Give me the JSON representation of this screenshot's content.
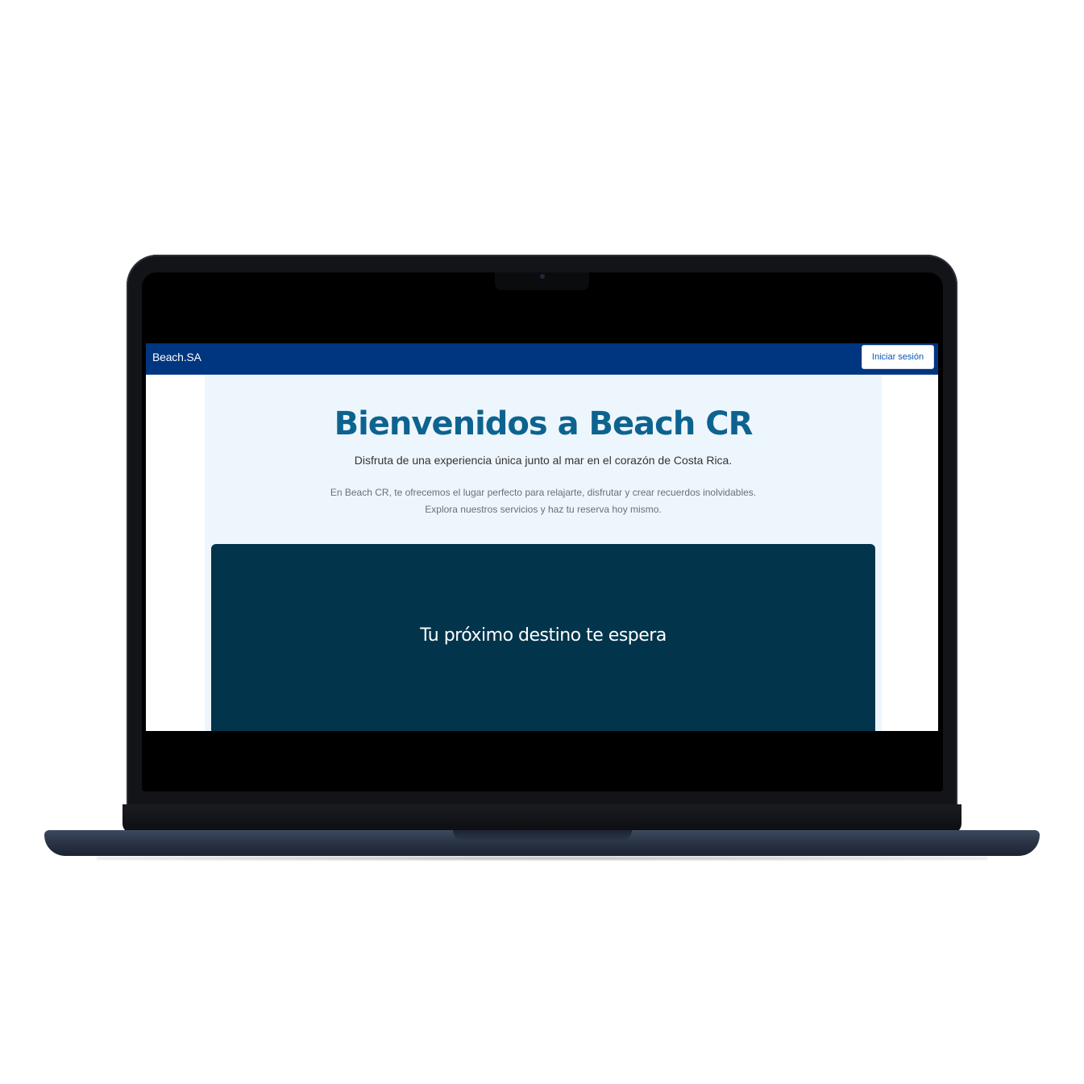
{
  "navbar": {
    "brand": "Beach.SA",
    "login_label": "Iniciar sesión"
  },
  "hero": {
    "title": "Bienvenidos a Beach CR",
    "subtitle": "Disfruta de una experiencia única junto al mar en el corazón de Costa Rica.",
    "body_line_1": "En Beach CR, te ofrecemos el lugar perfecto para relajarte, disfrutar y crear recuerdos inolvidables.",
    "body_line_2": "Explora nuestros servicios y haz tu reserva hoy mismo."
  },
  "banner": {
    "text": "Tu próximo destino te espera"
  },
  "colors": {
    "navbar": "#003580",
    "title": "#0d6390",
    "hero_background": "#eef6fd",
    "banner": "#02344b"
  }
}
